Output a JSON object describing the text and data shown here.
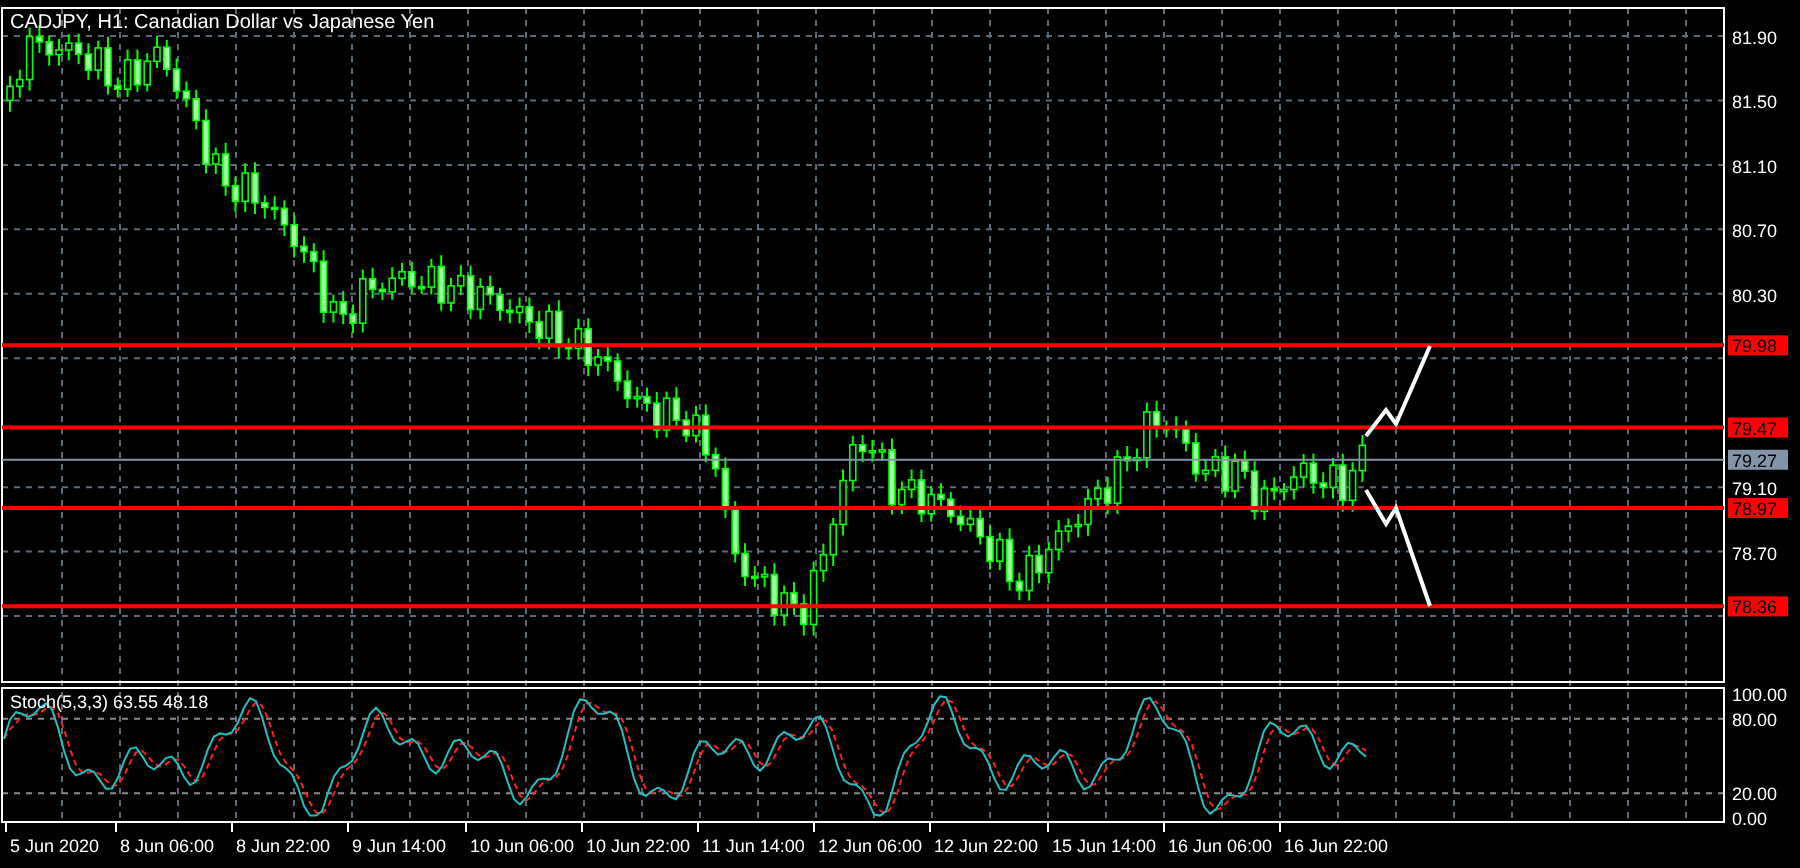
{
  "chart": {
    "title": "CADJPY, H1: Canadian Dollar vs Japanese Yen",
    "price_ticks": [
      "81.90",
      "81.50",
      "81.10",
      "80.70",
      "80.30",
      "79.10",
      "78.70"
    ],
    "levels": [
      "79.98",
      "79.47",
      "78.97",
      "78.36"
    ],
    "current_price": "79.27"
  },
  "indicator": {
    "title": "Stoch(5,3,3) 63.55 48.18",
    "ticks": [
      "100.00",
      "80.00",
      "20.00",
      "0.00"
    ]
  },
  "time_axis": [
    "5 Jun 2020",
    "8 Jun 06:00",
    "8 Jun 22:00",
    "9 Jun 14:00",
    "10 Jun 06:00",
    "10 Jun 22:00",
    "11 Jun 14:00",
    "12 Jun 06:00",
    "12 Jun 22:00",
    "15 Jun 14:00",
    "16 Jun 06:00",
    "16 Jun 22:00"
  ]
}
